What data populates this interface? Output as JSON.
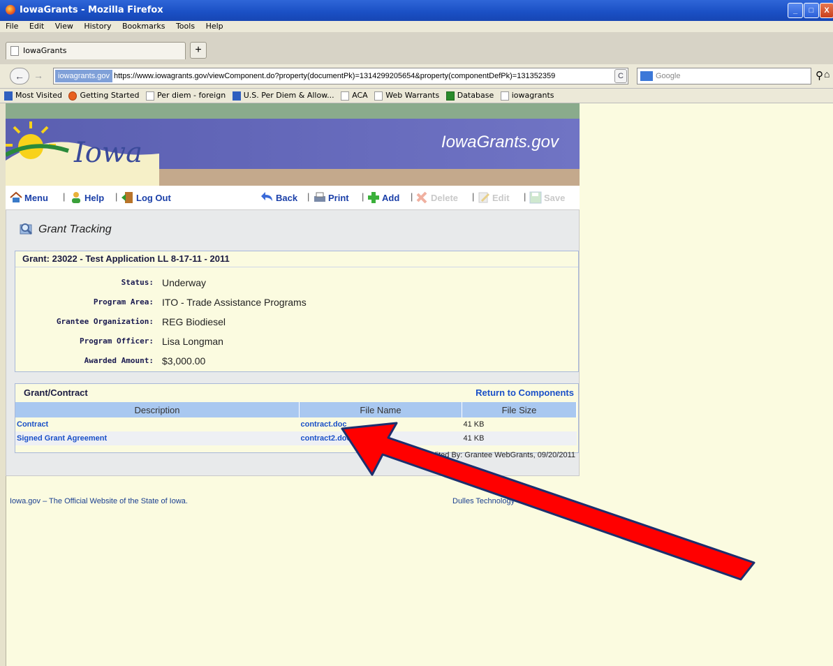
{
  "window": {
    "title": "IowaGrants - Mozilla Firefox",
    "min": "_",
    "max": "□",
    "close": "X"
  },
  "menubar": [
    "File",
    "Edit",
    "View",
    "History",
    "Bookmarks",
    "Tools",
    "Help"
  ],
  "tab": {
    "label": "IowaGrants",
    "new": "+"
  },
  "nav": {
    "back": "←",
    "forward": "→",
    "site_badge": "iowagrants.gov",
    "url": "https://www.iowagrants.gov/viewComponent.do?property(documentPk)=1314299205654&property(componentDefPk)=131352359",
    "search_placeholder": "Google",
    "reload": "C"
  },
  "bookmarks": [
    "Most Visited",
    "Getting Started",
    "Per diem - foreign",
    "U.S. Per Diem & Allow...",
    "ACA",
    "Web Warrants",
    "Database",
    "iowagrants"
  ],
  "banner": {
    "logo_text": "Iowa",
    "site_title": "IowaGrants.gov"
  },
  "toolbar": {
    "menu": "Menu",
    "help": "Help",
    "logout": "Log Out",
    "back": "Back",
    "print": "Print",
    "add": "Add",
    "delete": "Delete",
    "edit": "Edit",
    "save": "Save",
    "sep": "|"
  },
  "section_title": "Grant Tracking",
  "grant": {
    "header": "Grant: 23022 - Test Application LL 8-17-11 - 2011",
    "fields": [
      {
        "label": "Status:",
        "value": "Underway"
      },
      {
        "label": "Program Area:",
        "value": "ITO - Trade Assistance Programs"
      },
      {
        "label": "Grantee Organization:",
        "value": "REG Biodiesel"
      },
      {
        "label": "Program Officer:",
        "value": "Lisa Longman"
      },
      {
        "label": "Awarded Amount:",
        "value": "$3,000.00"
      }
    ]
  },
  "files": {
    "header": "Grant/Contract",
    "return_link": "Return to Components",
    "columns": [
      "Description",
      "File Name",
      "File Size"
    ],
    "rows": [
      {
        "description": "Contract",
        "file": "contract.doc",
        "size": "41 KB"
      },
      {
        "description": "Signed Grant Agreement",
        "file": "contract2.doc",
        "size": "41 KB"
      }
    ],
    "edited_by": "Last Edited By: Grantee WebGrants, 09/20/2011"
  },
  "footer": {
    "left": "Iowa.gov – The Official Website of the State of Iowa.",
    "right": "Dulles Technology"
  },
  "colors": {
    "arrow_fill": "#ff0000",
    "arrow_stroke": "#1c2f6e",
    "page_bg": "#fbfbe0",
    "link": "#1a50c8"
  }
}
